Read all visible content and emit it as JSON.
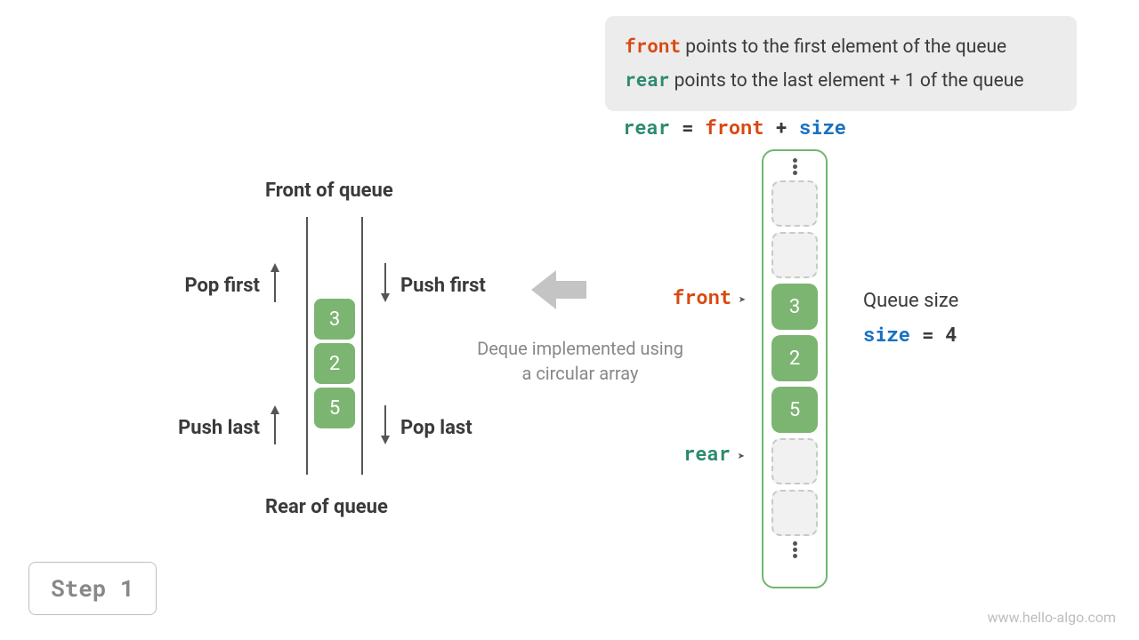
{
  "info_box": {
    "front_word": "front",
    "front_desc": " points to the first element of the queue",
    "rear_word": "rear",
    "rear_desc": " points to the last element + 1 of the queue"
  },
  "formula": {
    "rear": "rear",
    "eq": " = ",
    "front": "front",
    "plus": " + ",
    "size": "size"
  },
  "deque": {
    "front_label": "Front of queue",
    "rear_label": "Rear of queue",
    "pop_first": "Pop first",
    "push_first": "Push first",
    "push_last": "Push last",
    "pop_last": "Pop last",
    "cells": [
      "3",
      "2",
      "5"
    ]
  },
  "caption": {
    "line1": "Deque implemented using",
    "line2": "a circular array"
  },
  "array": {
    "front_label": "front",
    "rear_label": "rear",
    "slots": [
      {
        "type": "empty"
      },
      {
        "type": "empty"
      },
      {
        "type": "fill",
        "value": "3"
      },
      {
        "type": "fill",
        "value": "2"
      },
      {
        "type": "fill",
        "value": "5"
      },
      {
        "type": "empty"
      },
      {
        "type": "empty"
      }
    ]
  },
  "size_area": {
    "title": "Queue size",
    "size_word": "size",
    "eq": " = ",
    "value": "4"
  },
  "step_badge": "Step 1",
  "watermark": "www.hello-algo.com"
}
